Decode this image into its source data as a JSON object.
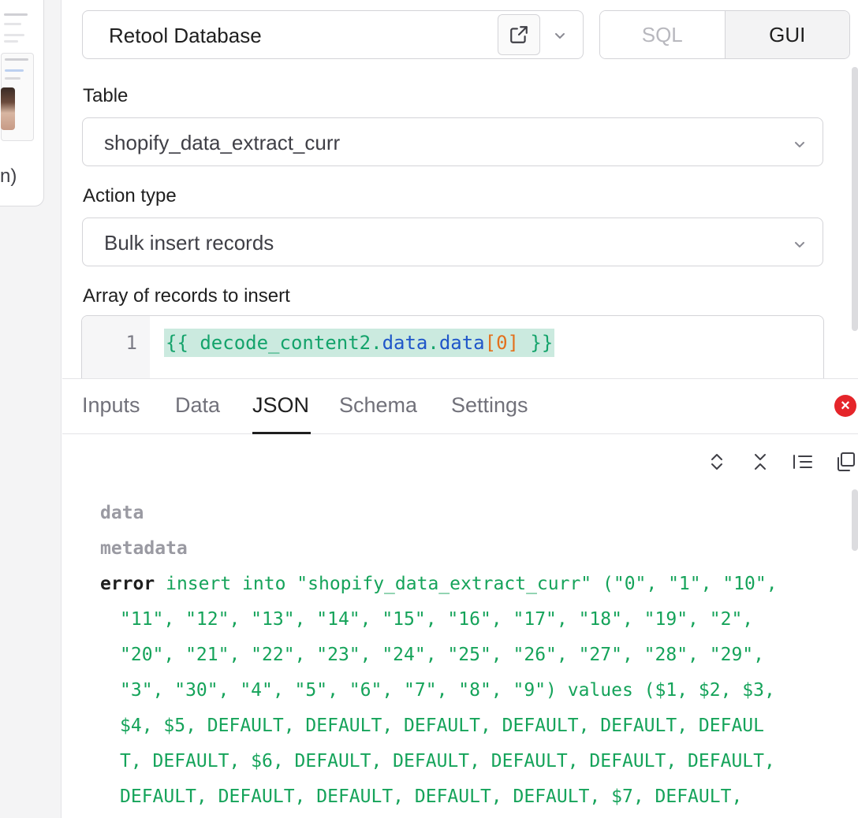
{
  "canvas": {
    "cut_text": "n)"
  },
  "resource": {
    "name": "Retool Database"
  },
  "mode": {
    "sql_label": "SQL",
    "gui_label": "GUI",
    "active": "GUI"
  },
  "table": {
    "label": "Table",
    "value": "shopify_data_extract_curr"
  },
  "action": {
    "label": "Action type",
    "value": "Bulk insert records"
  },
  "records": {
    "label": "Array of records to insert",
    "line_number": "1",
    "open_brace": "{{ ",
    "ident": "decode_content2",
    "dot1": ".",
    "prop1": "data",
    "dot2": ".",
    "prop2": "data",
    "bracket_open": "[",
    "index": "0",
    "bracket_close": "]",
    "close_brace": " }}"
  },
  "results": {
    "tabs": [
      {
        "label": "Inputs"
      },
      {
        "label": "Data"
      },
      {
        "label": "JSON"
      },
      {
        "label": "Schema"
      },
      {
        "label": "Settings"
      }
    ],
    "active_tab": "JSON",
    "error_icon_glyph": "×",
    "json": {
      "key_data": "data",
      "key_metadata": "metadata",
      "key_error": "error",
      "error_lines": [
        "insert into \"shopify_data_extract_curr\" (\"0\", \"1\", \"10\",",
        "\"11\", \"12\", \"13\", \"14\", \"15\", \"16\", \"17\", \"18\", \"19\", \"2\",",
        "\"20\", \"21\", \"22\", \"23\", \"24\", \"25\", \"26\", \"27\", \"28\", \"29\",",
        "\"3\", \"30\", \"4\", \"5\", \"6\", \"7\", \"8\", \"9\") values ($1, $2, $3,",
        "$4, $5, DEFAULT, DEFAULT, DEFAULT, DEFAULT, DEFAULT, DEFAUL",
        "T, DEFAULT, $6, DEFAULT, DEFAULT, DEFAULT, DEFAULT, DEFAULT,",
        "DEFAULT, DEFAULT, DEFAULT, DEFAULT, DEFAULT, $7, DEFAULT,"
      ]
    }
  },
  "icons": {
    "open_external": "external-link-icon",
    "dropdown": "chevron-down-icon",
    "expand_all": "expand-all-icon",
    "collapse_all": "collapse-all-icon",
    "format": "format-lines-icon",
    "copy": "copy-icon"
  },
  "colors": {
    "code_green": "#14a36b",
    "code_blue": "#1f56c9",
    "code_orange": "#e3701c",
    "highlight": "#cbeadf",
    "error_red": "#e5252a"
  }
}
